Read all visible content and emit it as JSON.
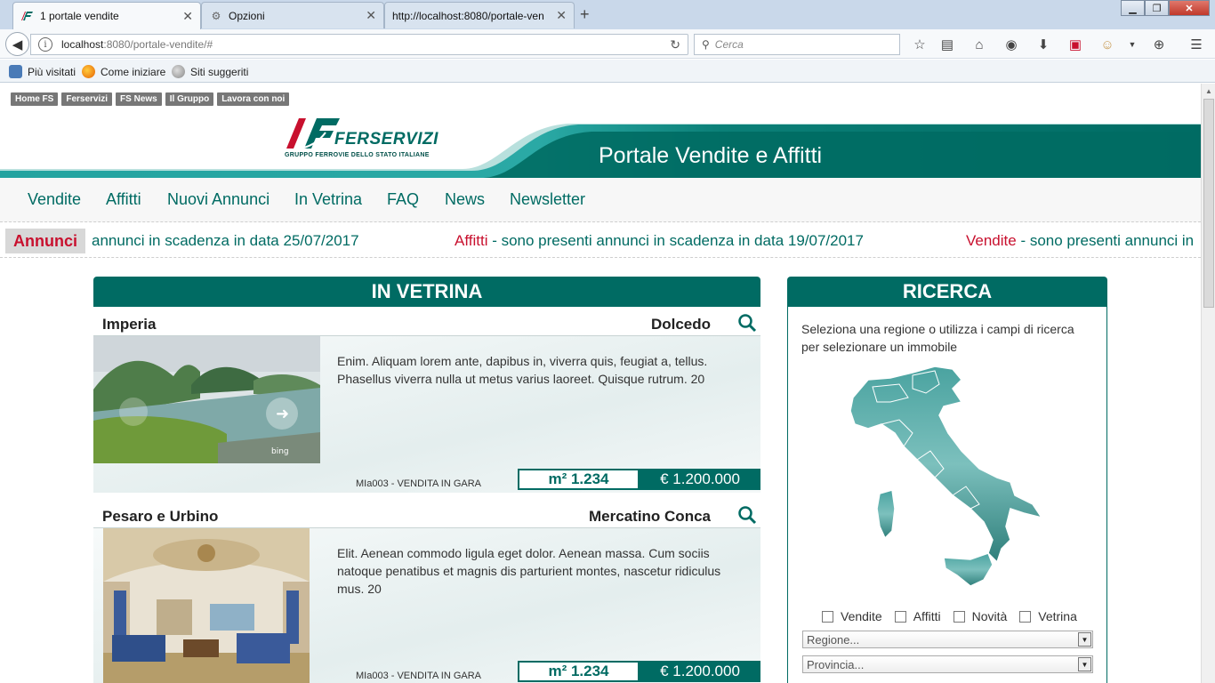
{
  "browser": {
    "tabs": [
      {
        "title": "1 portale vendite",
        "active": true,
        "favicon": "fs-logo-icon"
      },
      {
        "title": "Opzioni",
        "active": false,
        "favicon": "gear-icon"
      },
      {
        "title": "http://localhost:8080/portale-ven",
        "active": false,
        "favicon": ""
      }
    ],
    "url_host": "localhost",
    "url_rest": ":8080/portale-vendite/#",
    "search_placeholder": "Cerca",
    "bookmarks": [
      {
        "label": "Più visitati",
        "icon": "bookmarks-icon"
      },
      {
        "label": "Come iniziare",
        "icon": "firefox-icon"
      },
      {
        "label": "Siti suggeriti",
        "icon": "globe-icon"
      }
    ]
  },
  "toplinks": [
    "Home FS",
    "Ferservizi",
    "FS News",
    "Il Gruppo",
    "Lavora con noi"
  ],
  "brand": {
    "name": "FERSERVIZI",
    "subtitle": "GRUPPO FERROVIE DELLO STATO ITALIANE",
    "portal_title": "Portale Vendite e Affitti"
  },
  "nav": [
    "Vendite",
    "Affitti",
    "Nuovi Annunci",
    "In Vetrina",
    "FAQ",
    "News",
    "Newsletter"
  ],
  "ticker": {
    "label": "Annunci",
    "items": [
      {
        "category": "",
        "text": "annunci in scadenza in data 25/07/2017"
      },
      {
        "category": "Affitti",
        "text": " - sono presenti annunci in scadenza in data 19/07/2017"
      },
      {
        "category": "Vendite",
        "text": " - sono presenti annunci in"
      }
    ]
  },
  "vetrina": {
    "title": "IN VETRINA",
    "cards": [
      {
        "province": "Imperia",
        "town": "Dolcedo",
        "description": "Enim. Aliquam lorem ante, dapibus in, viverra quis, feugiat a, tellus. Phasellus viverra nulla ut metus varius laoreet. Quisque rutrum. 20",
        "code": "MIa003 - VENDITA IN GARA",
        "area": "m² 1.234",
        "price": "€ 1.200.000"
      },
      {
        "province": "Pesaro e Urbino",
        "town": "Mercatino Conca",
        "description": "Elit. Aenean commodo ligula eget dolor. Aenean massa. Cum sociis natoque penatibus et magnis dis parturient montes, nascetur ridiculus mus. 20",
        "code": "MIa003 - VENDITA IN GARA",
        "area": "m² 1.234",
        "price": "€ 1.200.000"
      }
    ]
  },
  "ricerca": {
    "title": "RICERCA",
    "hint": "Seleziona una regione o utilizza i campi di ricerca per selezionare un immobile",
    "checkboxes": [
      "Vendite",
      "Affitti",
      "Novità",
      "Vetrina"
    ],
    "selects": [
      "Regione...",
      "Provincia..."
    ]
  },
  "colors": {
    "brand": "#006b63",
    "accent": "#c8102e"
  }
}
